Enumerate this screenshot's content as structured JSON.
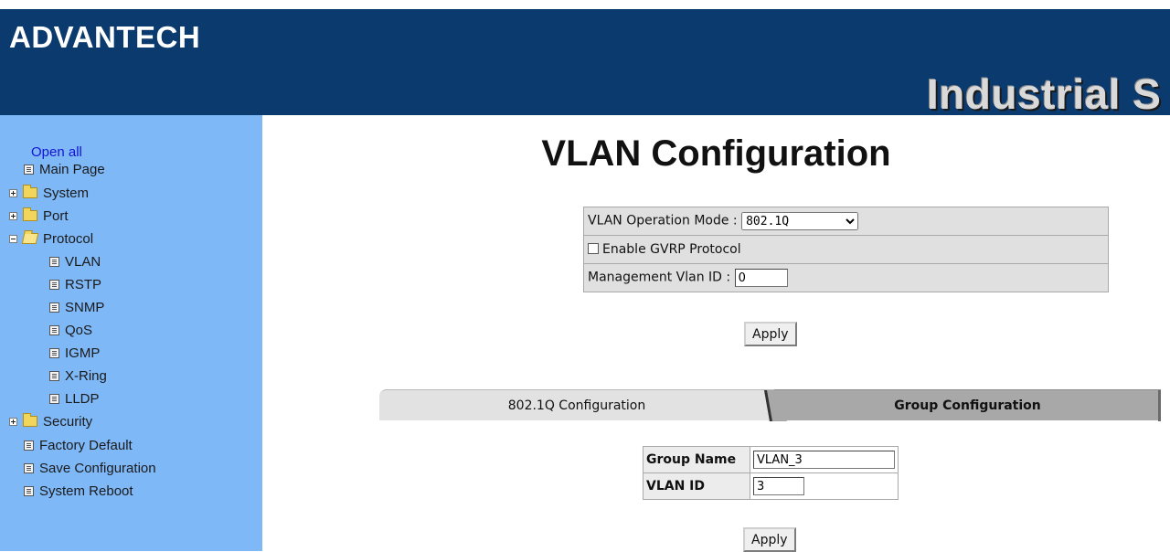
{
  "header": {
    "logo": "ADVANTECH",
    "banner": "Industrial S"
  },
  "sidebar": {
    "open_all": "Open all",
    "items": [
      {
        "label": "Main Page",
        "type": "doc"
      },
      {
        "label": "System",
        "type": "folder",
        "expanded": false
      },
      {
        "label": "Port",
        "type": "folder",
        "expanded": false
      },
      {
        "label": "Protocol",
        "type": "folder",
        "expanded": true
      },
      {
        "label": "VLAN",
        "type": "doc"
      },
      {
        "label": "RSTP",
        "type": "doc"
      },
      {
        "label": "SNMP",
        "type": "doc"
      },
      {
        "label": "QoS",
        "type": "doc"
      },
      {
        "label": "IGMP",
        "type": "doc"
      },
      {
        "label": "X-Ring",
        "type": "doc"
      },
      {
        "label": "LLDP",
        "type": "doc"
      },
      {
        "label": "Security",
        "type": "folder",
        "expanded": false
      },
      {
        "label": "Factory Default",
        "type": "doc"
      },
      {
        "label": "Save Configuration",
        "type": "doc"
      },
      {
        "label": "System Reboot",
        "type": "doc"
      }
    ]
  },
  "main": {
    "title": "VLAN Configuration",
    "vlan_mode_label": "VLAN Operation Mode :",
    "vlan_mode_value": "802.1Q",
    "gvrp_label": "Enable GVRP Protocol",
    "gvrp_checked": false,
    "mgmt_label": "Management Vlan ID :",
    "mgmt_value": "0",
    "apply_label": "Apply",
    "tabs": [
      {
        "label": "802.1Q Configuration",
        "active": false
      },
      {
        "label": "Group Configuration",
        "active": true
      }
    ],
    "group_name_label": "Group Name",
    "group_name_value": "VLAN_3",
    "vlan_id_label": "VLAN ID",
    "vlan_id_value": "3",
    "apply2_label": "Apply"
  },
  "colors": {
    "header_bg": "#0b3a6e",
    "sidebar_bg": "#7fb8f7",
    "link": "#1414d2"
  }
}
